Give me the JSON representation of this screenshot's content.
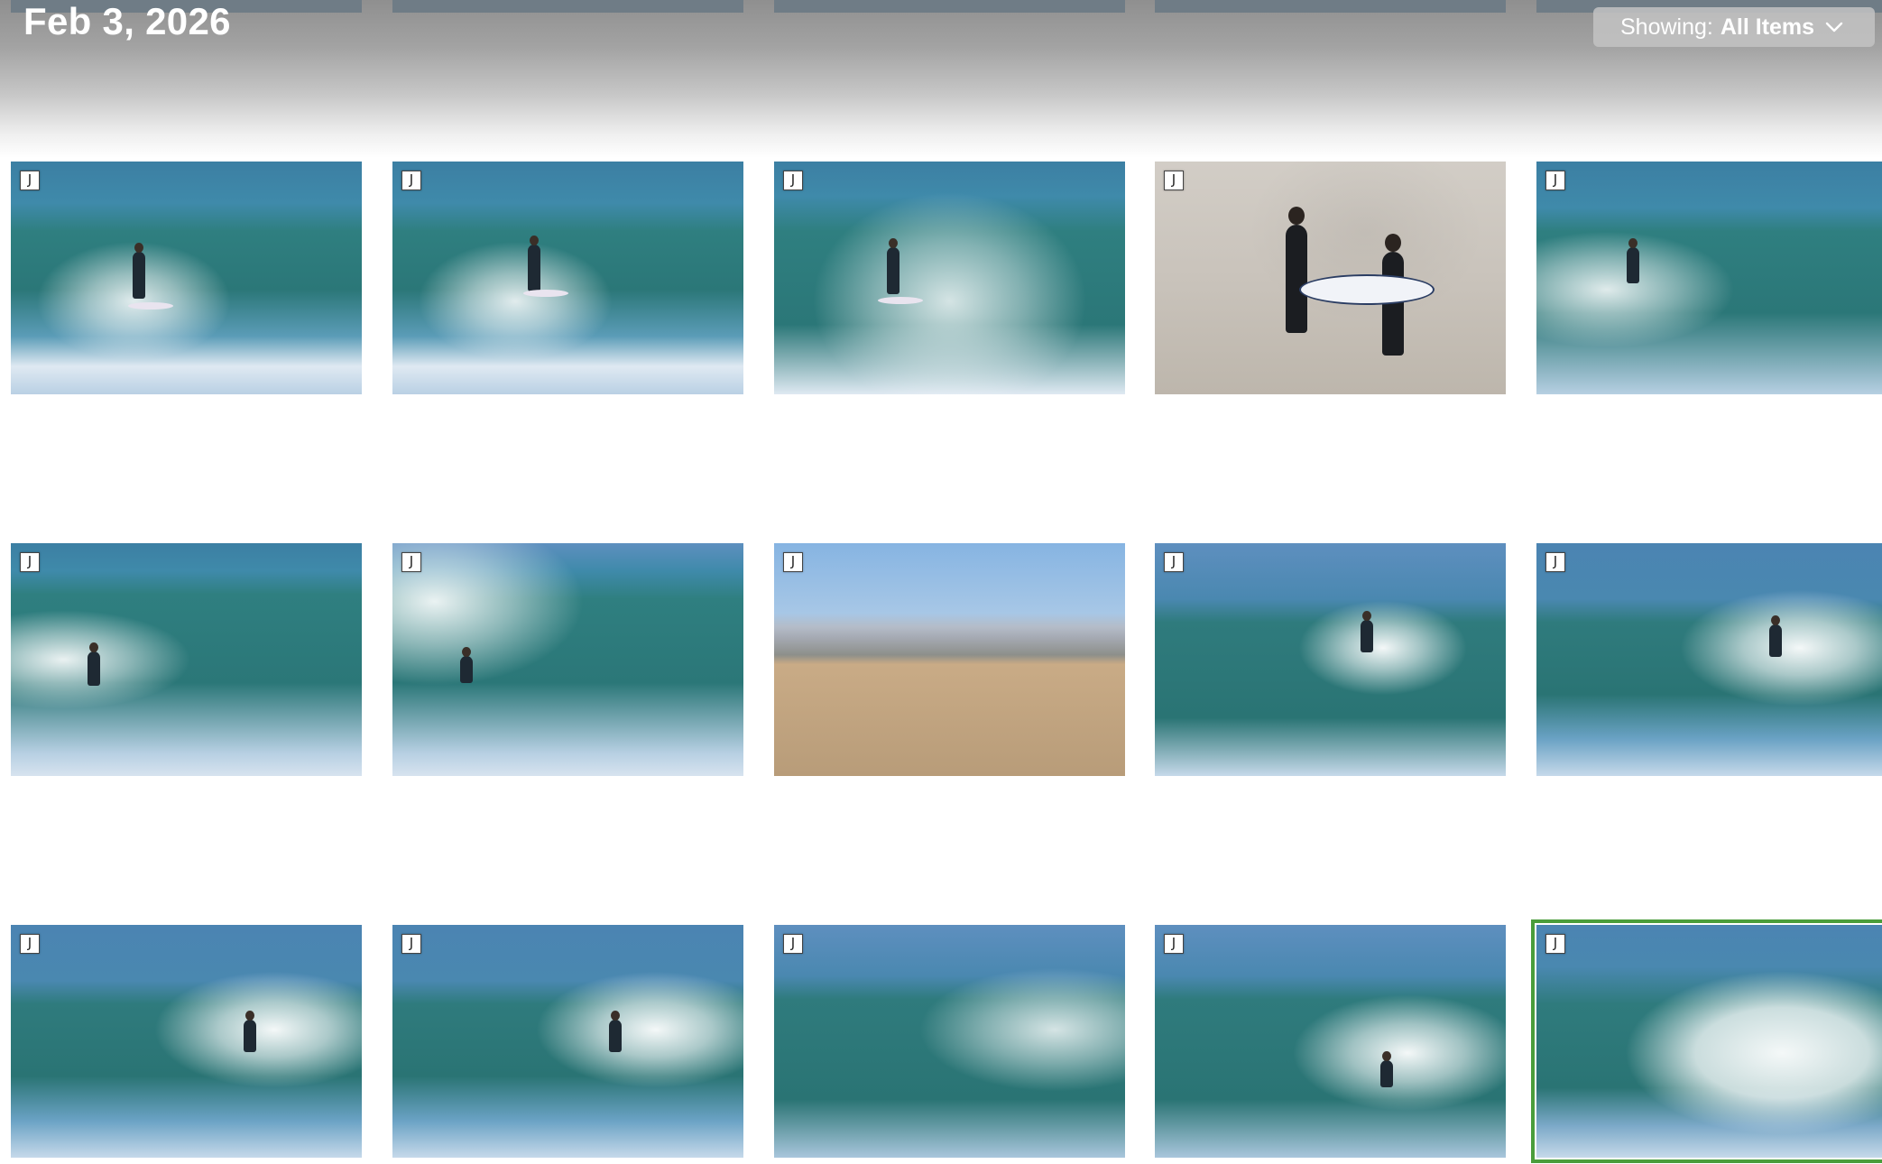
{
  "header": {
    "date": "Feb 3, 2026",
    "filter_label": "Showing:",
    "filter_value": "All Items"
  },
  "thumb_badge": "J",
  "rows": [
    [
      {
        "subject": "surfer-on-wave"
      },
      {
        "subject": "surfer-on-wave"
      },
      {
        "subject": "surfer-whitewater"
      },
      {
        "subject": "two-surfers-walking-beach"
      },
      {
        "subject": "surfer-on-wave"
      }
    ],
    [
      {
        "subject": "surfer-on-wave"
      },
      {
        "subject": "surfer-on-wave"
      },
      {
        "subject": "beach-scene"
      },
      {
        "subject": "surfer-spray"
      },
      {
        "subject": "surfer-spray"
      }
    ],
    [
      {
        "subject": "surfer-barrel"
      },
      {
        "subject": "surfer-barrel"
      },
      {
        "subject": "wave-barrel"
      },
      {
        "subject": "surfer-barrel"
      },
      {
        "subject": "wave-spray",
        "selected": true
      }
    ]
  ],
  "colors": {
    "selection": "#4a9d3b",
    "header_text": "#ffffff"
  }
}
